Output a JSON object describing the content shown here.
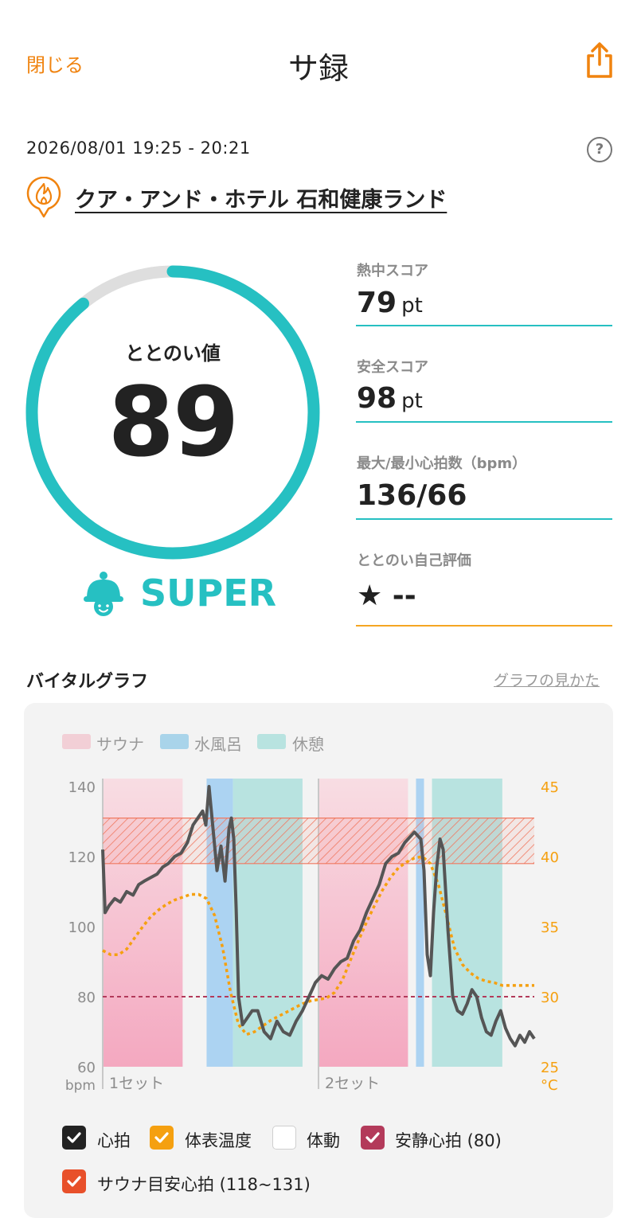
{
  "header": {
    "close_label": "閉じる",
    "title": "サ録",
    "share_icon": "share-icon"
  },
  "session": {
    "datetime": "2026/08/01 19:25 - 20:21",
    "help_label": "?",
    "facility_name": "クア・アンド・ホテル 石和健康ランド"
  },
  "totonoi": {
    "label": "ととのい値",
    "value": "89",
    "fraction": 0.89,
    "rank": "SUPER"
  },
  "stats": [
    {
      "label": "熱中スコア",
      "value": "79",
      "unit": "pt"
    },
    {
      "label": "安全スコア",
      "value": "98",
      "unit": "pt"
    },
    {
      "label": "最大/最小心拍数（bpm）",
      "value": "136/66",
      "unit": ""
    },
    {
      "label": "ととのい自己評価",
      "value": "★ --",
      "unit": ""
    }
  ],
  "vital": {
    "title": "バイタルグラフ",
    "howto_link": "グラフの見かた"
  },
  "legend": [
    {
      "label": "サウナ",
      "color": "#f2cfd6"
    },
    {
      "label": "水風呂",
      "color": "#a9d4ea"
    },
    {
      "label": "休憩",
      "color": "#b8e3e0"
    }
  ],
  "checkboxes": [
    {
      "label": "心拍",
      "checked": true,
      "color": "#222222"
    },
    {
      "label": "体表温度",
      "checked": true,
      "color": "#f5a010"
    },
    {
      "label": "体動",
      "checked": false,
      "color": "#ffffff"
    },
    {
      "label": "安静心拍 (80)",
      "checked": true,
      "color": "#b33a5a"
    },
    {
      "label": "サウナ目安心拍 (118~131)",
      "checked": true,
      "color": "#e8502a"
    }
  ],
  "chart_data": {
    "type": "line",
    "title": "",
    "y_left": {
      "label": "bpm",
      "range": [
        60,
        140
      ],
      "ticks": [
        140,
        120,
        100,
        80,
        60
      ]
    },
    "y_right": {
      "label": "°C",
      "range": [
        25,
        45
      ],
      "ticks": [
        45,
        40,
        35,
        30,
        25
      ]
    },
    "x_labels": [
      "1セット",
      "2セット"
    ],
    "x_range": [
      0,
      54
    ],
    "phases": [
      {
        "type": "sauna",
        "start": 0,
        "end": 10
      },
      {
        "type": "water",
        "start": 13,
        "end": 16.3
      },
      {
        "type": "rest",
        "start": 16.3,
        "end": 25
      },
      {
        "type": "sauna",
        "start": 27,
        "end": 38.2
      },
      {
        "type": "water",
        "start": 39.2,
        "end": 40.2
      },
      {
        "type": "rest",
        "start": 41.2,
        "end": 50
      }
    ],
    "set_dividers": [
      0,
      27
    ],
    "resting_hr": 80,
    "sauna_target_hr": [
      118,
      131
    ],
    "series": [
      {
        "name": "心拍",
        "color": "#555555",
        "x": [
          0,
          0.3,
          0.8,
          1.5,
          2.2,
          3,
          3.8,
          4.5,
          5.2,
          6,
          6.8,
          7.5,
          8.2,
          9,
          9.8,
          10.6,
          11.3,
          11.9,
          12.5,
          12.9,
          13.3,
          13.8,
          14.3,
          14.8,
          15.3,
          15.8,
          16.1,
          16.4,
          16.7,
          17,
          17.5,
          18.1,
          18.7,
          19.4,
          20.2,
          21,
          21.8,
          22.6,
          23.4,
          24.2,
          25,
          25.8,
          26.6,
          27.4,
          28.2,
          29,
          29.8,
          30.6,
          31.4,
          32.2,
          33,
          33.8,
          34.6,
          35.4,
          36.2,
          37,
          37.8,
          38.6,
          39,
          39.4,
          39.8,
          40.2,
          40.6,
          41,
          41.4,
          41.8,
          42.2,
          42.6,
          43.2,
          43.8,
          44.4,
          45,
          45.6,
          46.2,
          46.8,
          47.4,
          48,
          48.6,
          49.2,
          49.8,
          50.4,
          51,
          51.6,
          52.2,
          52.8,
          53.4,
          54
        ],
        "y": [
          122,
          104,
          106,
          108,
          107,
          110,
          109,
          112,
          113,
          114,
          115,
          117,
          118,
          120,
          121,
          124,
          129,
          131,
          133,
          129,
          140,
          128,
          116,
          123,
          113,
          128,
          131,
          125,
          105,
          80,
          72,
          74,
          76,
          76,
          70,
          68,
          73,
          70,
          69,
          73,
          76,
          80,
          84,
          86,
          85,
          88,
          90,
          91,
          96,
          99,
          104,
          108,
          112,
          118,
          120,
          121,
          124,
          126,
          127,
          126,
          125,
          116,
          92,
          86,
          104,
          117,
          125,
          122,
          99,
          80,
          76,
          75,
          78,
          82,
          80,
          74,
          70,
          69,
          73,
          76,
          71,
          68,
          66,
          69,
          67,
          70,
          68
        ]
      },
      {
        "name": "体表温度",
        "color": "#f5a010",
        "x": [
          0,
          1,
          2,
          3,
          4,
          5,
          6,
          7,
          8,
          9,
          10,
          11,
          12,
          13,
          14,
          15,
          16,
          17,
          18,
          19,
          20,
          21,
          22,
          23,
          24,
          25,
          26,
          27,
          28,
          29,
          30,
          31,
          32,
          33,
          34,
          35,
          36,
          37,
          38,
          39,
          40,
          41,
          42,
          43,
          44,
          45,
          46,
          47,
          48,
          49,
          50,
          51,
          52,
          53,
          54
        ],
        "y": [
          33.3,
          33.0,
          33.0,
          33.4,
          34.2,
          35.0,
          35.7,
          36.2,
          36.6,
          36.9,
          37.1,
          37.3,
          37.3,
          37.0,
          35.8,
          33.5,
          30.3,
          28.0,
          27.3,
          27.5,
          27.9,
          28.3,
          28.6,
          28.9,
          29.2,
          29.5,
          29.7,
          29.8,
          29.9,
          30.3,
          31.2,
          32.6,
          34.0,
          35.3,
          36.5,
          37.6,
          38.5,
          39.2,
          39.6,
          39.9,
          40.0,
          39.5,
          38.0,
          35.8,
          33.5,
          32.3,
          31.7,
          31.3,
          31.1,
          31.0,
          30.8,
          30.8,
          30.8,
          30.8,
          30.8
        ]
      }
    ]
  }
}
